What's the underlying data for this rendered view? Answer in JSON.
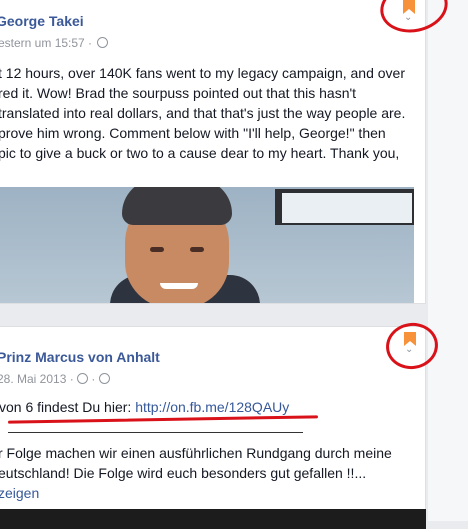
{
  "colors": {
    "link": "#3b5998",
    "annotation": "#d9121a",
    "bookmark": "#f7923a"
  },
  "post1": {
    "author": "George Takei",
    "timestamp": "estern um 15:57 ·",
    "lines": [
      "t 12 hours, over 140K fans went to my legacy campaign, and over",
      "red it. Wow! Brad the sourpuss pointed out that this hasn't",
      "translated into real dollars, and that that's just the way people are.",
      " prove him wrong. Comment below with \"I'll help, George!\" then",
      "pic to give a buck or two to a cause dear to my heart. Thank you,"
    ],
    "save_icon": "bookmark-icon",
    "menu_icon": "chevron-down-icon"
  },
  "post2": {
    "author": "Prinz Marcus von Anhalt",
    "timestamp": "28. Mai 2013 · ",
    "link_prefix": "von 6 findest Du hier: ",
    "link_text": "http://on.fb.me/128QAUy",
    "body_line1": "r Folge machen wir einen ausführlichen Rundgang durch meine",
    "body_line2": "eutschland! Die Folge wird euch besonders gut gefallen !!...",
    "more_label": "zeigen",
    "save_icon": "bookmark-icon",
    "menu_icon": "chevron-down-icon"
  }
}
